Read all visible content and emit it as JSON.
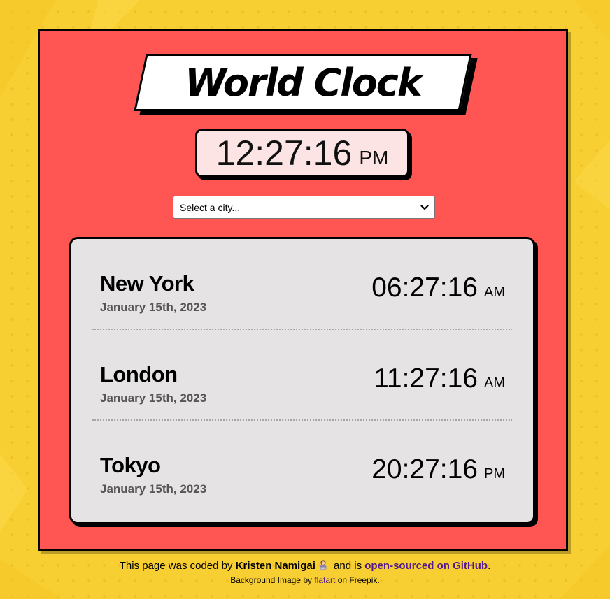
{
  "header": {
    "title": "World Clock"
  },
  "main_clock": {
    "time": "12:27:16",
    "period": "PM"
  },
  "city_select": {
    "selected_label": "Select a city..."
  },
  "cities": [
    {
      "name": "New York",
      "date": "January 15th, 2023",
      "time": "06:27:16",
      "period": "AM"
    },
    {
      "name": "London",
      "date": "January 15th, 2023",
      "time": "11:27:16",
      "period": "AM"
    },
    {
      "name": "Tokyo",
      "date": "January 15th, 2023",
      "time": "20:27:16",
      "period": "PM"
    }
  ],
  "footer": {
    "prefix": "This page was coded by",
    "author": "Kristen Namigai",
    "author_icon": "woman-technologist-icon",
    "middle": "and is",
    "github_link": "open-sourced on GitHub",
    "suffix": ".",
    "credit_prefix": "Background Image by",
    "credit_link": "flatart",
    "credit_suffix": "on Freepik."
  },
  "colors": {
    "background": "#f8cf32",
    "card": "#ff5653",
    "main_clock_bg": "#fde4e4",
    "panel": "#e5e3e4",
    "link": "#551a8b"
  }
}
